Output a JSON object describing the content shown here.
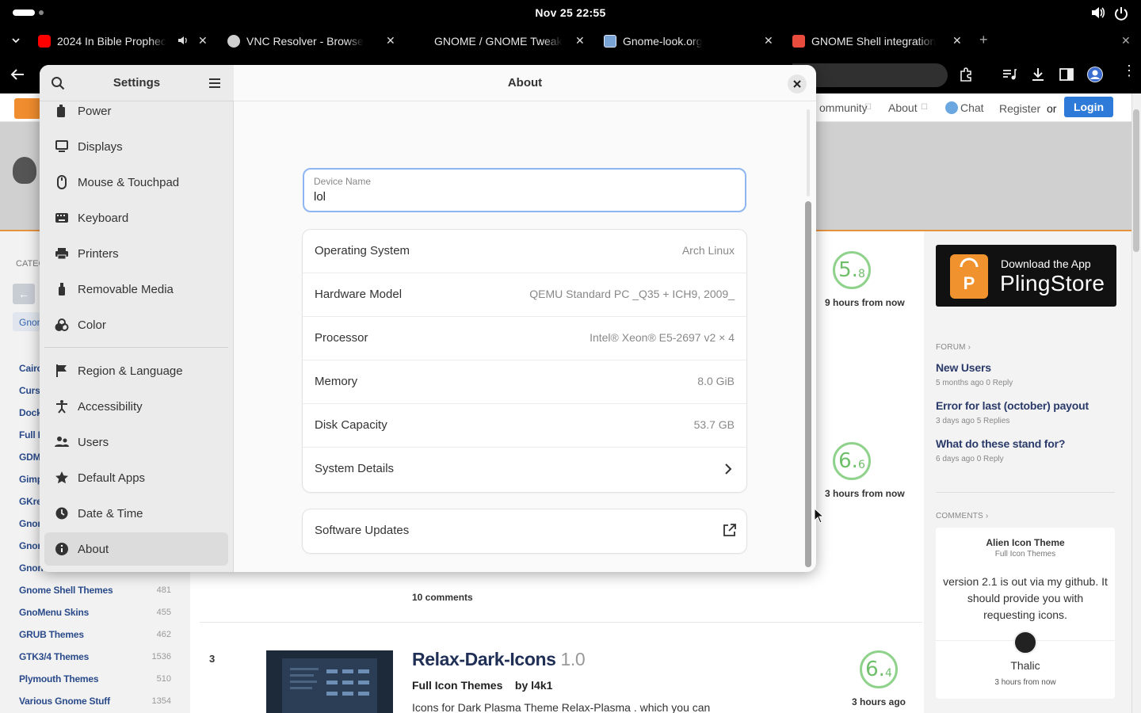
{
  "topbar": {
    "clock": "Nov 25  22:55"
  },
  "browser": {
    "tabs": [
      {
        "label": "2024 In Bible Prophec",
        "favicon": "youtube-icon",
        "color": "#ff0000"
      },
      {
        "label": "VNC Resolver - Browse",
        "favicon": "vnc-icon",
        "color": "#cccccc"
      },
      {
        "label": "GNOME / GNOME Tweak",
        "favicon": "gitlab-icon",
        "color": "#000000"
      },
      {
        "label": "Gnome-look.org",
        "favicon": "gnome-look-icon",
        "color": "#7aa3d6"
      },
      {
        "label": "GNOME Shell integration",
        "favicon": "gnome-icon",
        "color": "#e94b3c"
      }
    ],
    "new_tab": "+"
  },
  "website": {
    "nav": {
      "community": "ommunity",
      "about": "About",
      "chat": "Chat",
      "register": "Register",
      "or": "or",
      "login": "Login"
    },
    "categories_heading": "CATEG",
    "gnome_chip": "Gnom",
    "categories": [
      {
        "label": "Cairo",
        "count": ""
      },
      {
        "label": "Curs",
        "count": ""
      },
      {
        "label": "Dock",
        "count": ""
      },
      {
        "label": "Full I",
        "count": ""
      },
      {
        "label": "GDM",
        "count": ""
      },
      {
        "label": "Gimp",
        "count": ""
      },
      {
        "label": "GKre",
        "count": ""
      },
      {
        "label": "Gnon",
        "count": ""
      },
      {
        "label": "Gnon",
        "count": ""
      },
      {
        "label": "Gnon",
        "count": ""
      },
      {
        "label": "Gnome Shell Themes",
        "count": "481"
      },
      {
        "label": "GnoMenu Skins",
        "count": "455"
      },
      {
        "label": "GRUB Themes",
        "count": "462"
      },
      {
        "label": "GTK3/4 Themes",
        "count": "1536"
      },
      {
        "label": "Plymouth Themes",
        "count": "510"
      },
      {
        "label": "Various Gnome Stuff",
        "count": "1354"
      }
    ],
    "scores": [
      {
        "score": "5.",
        "decimal": "8",
        "when": "9 hours from now"
      },
      {
        "score": "6.",
        "decimal": "6",
        "when": "3 hours from now"
      },
      {
        "score": "6.",
        "decimal": "4",
        "when": "3 hours ago"
      }
    ],
    "comments_count": "10 comments",
    "item3": {
      "rank": "3",
      "title": "Relax-Dark-Icons",
      "version": "1.0",
      "category": "Full Icon Themes",
      "by": "by l4k1",
      "desc": "Icons for Dark Plasma Theme Relax-Plasma . which you can"
    },
    "pling": {
      "line1": "Download the App",
      "line2": "PlingStore"
    },
    "forum_heading": "FORUM ›",
    "forum": [
      {
        "title": "New Users",
        "meta": "5 months ago   0 Reply"
      },
      {
        "title": "Error for last (october) payout",
        "meta": "3 days ago   5 Replies"
      },
      {
        "title": "What do these stand for?",
        "meta": "6 days ago   0 Reply"
      }
    ],
    "comments_heading": "COMMENTS ›",
    "comment": {
      "title": "Alien Icon Theme",
      "sub": "Full Icon Themes",
      "text": "version 2.1 is out via my github. It should provide you with requesting icons.",
      "user": "Thalic",
      "when": "3 hours from now"
    }
  },
  "settings": {
    "sidebar_title": "Settings",
    "main_title": "About",
    "sidebar_items": [
      {
        "label": "Power",
        "icon": "power-icon"
      },
      {
        "label": "Displays",
        "icon": "display-icon"
      },
      {
        "label": "Mouse & Touchpad",
        "icon": "mouse-icon"
      },
      {
        "label": "Keyboard",
        "icon": "keyboard-icon"
      },
      {
        "label": "Printers",
        "icon": "printer-icon"
      },
      {
        "label": "Removable Media",
        "icon": "usb-icon"
      },
      {
        "label": "Color",
        "icon": "color-icon"
      },
      {
        "label": "Region & Language",
        "icon": "flag-icon"
      },
      {
        "label": "Accessibility",
        "icon": "accessibility-icon"
      },
      {
        "label": "Users",
        "icon": "users-icon"
      },
      {
        "label": "Default Apps",
        "icon": "star-icon"
      },
      {
        "label": "Date & Time",
        "icon": "clock-icon"
      },
      {
        "label": "About",
        "icon": "info-icon"
      }
    ],
    "device_name": {
      "label": "Device Name",
      "value": "lol"
    },
    "info": [
      {
        "key": "Operating System",
        "value": "Arch Linux"
      },
      {
        "key": "Hardware Model",
        "value": "QEMU Standard PC _Q35 + ICH9, 2009_"
      },
      {
        "key": "Processor",
        "value": "Intel® Xeon® E5-2697 v2 × 4"
      },
      {
        "key": "Memory",
        "value": "8.0 GiB"
      },
      {
        "key": "Disk Capacity",
        "value": "53.7 GB"
      },
      {
        "key": "System Details",
        "value": ""
      }
    ],
    "software_updates": "Software Updates"
  }
}
